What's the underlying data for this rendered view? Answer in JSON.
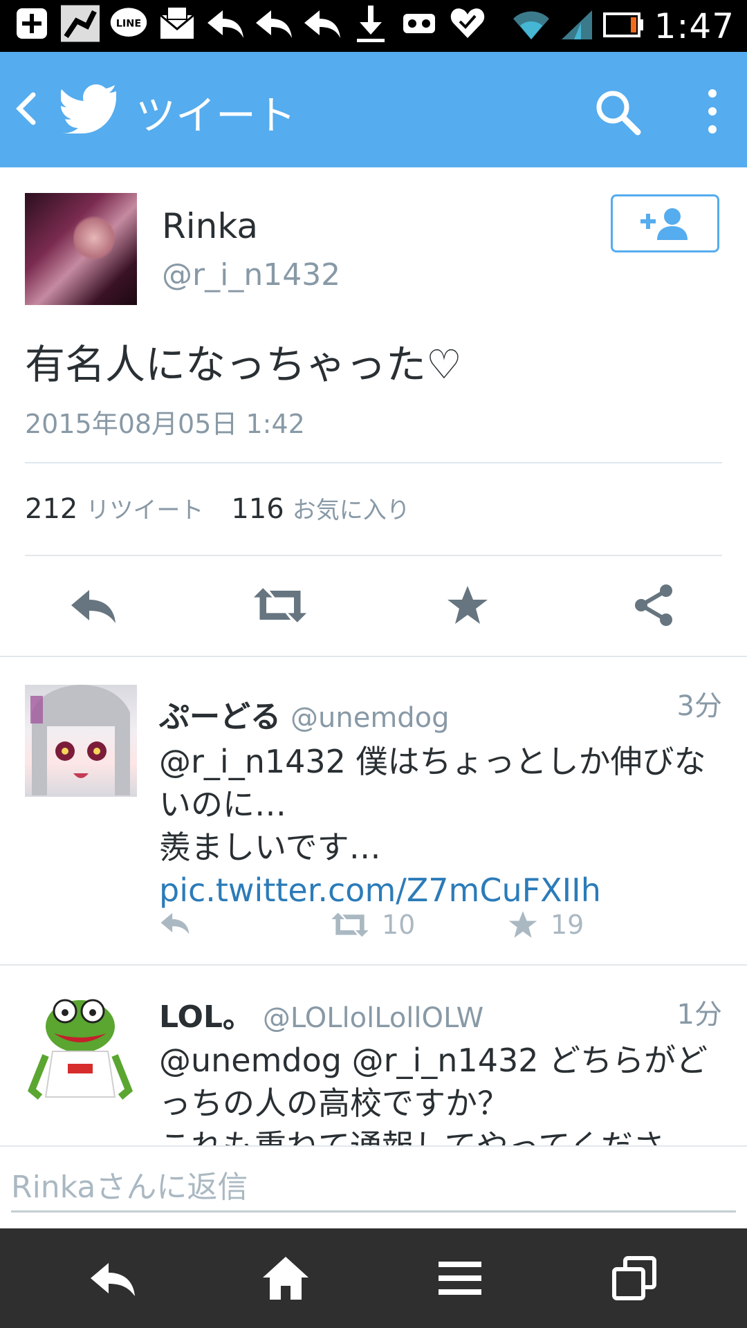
{
  "status_bar": {
    "time": "1:47",
    "icons": [
      "plus-square-icon",
      "app-icon",
      "line-icon",
      "mail-icon",
      "reply-icon",
      "reply-icon",
      "reply-icon",
      "download-icon",
      "voicemail-icon",
      "heart-icon",
      "wifi-icon",
      "signal-icon",
      "battery-icon"
    ],
    "battery_level": 0.1
  },
  "app_bar": {
    "title": "ツイート",
    "color": "#55acee"
  },
  "tweet": {
    "name": "Rinka",
    "handle": "@r_i_n1432",
    "text": "有名人になっちゃった♡",
    "timestamp": "2015年08月05日 1:42",
    "retweet_count": "212",
    "retweet_label": "リツイート",
    "favorite_count": "116",
    "favorite_label": "お気に入り"
  },
  "replies": [
    {
      "name": "ぷーどる",
      "handle": "@unemdog",
      "time": "3分",
      "mention": "@r_i_n1432",
      "text_line1": " 僕はちょっとしか伸びないのに…",
      "text_line2": "羨ましいです… ",
      "link": "pic.twitter.com/Z7mCuFXIIh",
      "retweets": "10",
      "favorites": "19"
    },
    {
      "name": "LOL。",
      "handle": "@LOLlolLollOLW",
      "time": "1分",
      "mention": "@unemdog @r_i_n1432",
      "text_line1": " どちらがどっちの人の高校ですか？",
      "text_line2": "これも重ねて通報してやってくださ"
    }
  ],
  "composer": {
    "placeholder": "Rinkaさんに返信"
  },
  "colors": {
    "accent": "#55acee",
    "link": "#2b7bb9",
    "muted": "#8899a6",
    "action": "#66757f"
  }
}
